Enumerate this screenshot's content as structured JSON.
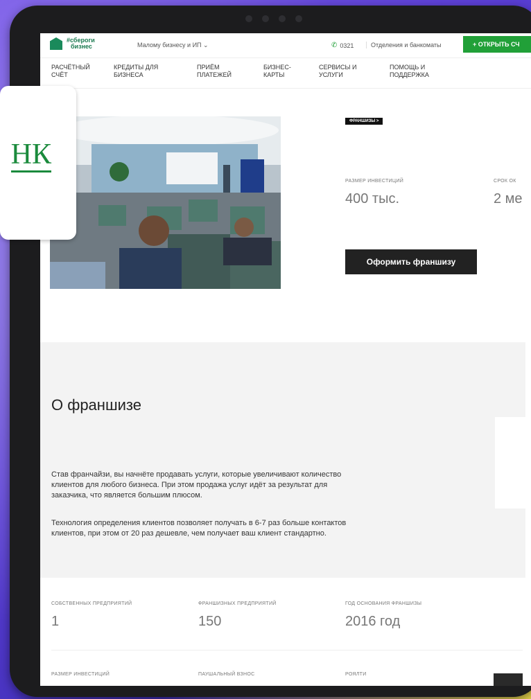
{
  "header": {
    "logo_line1": "#сбероги",
    "logo_line2": "бизнес",
    "segment": "Малому бизнесу и ИП ⌄",
    "phone": "0321",
    "branches": "Отделения и банкоматы",
    "open_account": "+ ОТКРЫТЬ СЧ"
  },
  "nav": [
    {
      "l1": "РАСЧЁТНЫЙ",
      "l2": "СЧЁТ"
    },
    {
      "l1": "КРЕДИТЫ ДЛЯ",
      "l2": "БИЗНЕСА"
    },
    {
      "l1": "ПРИЁМ",
      "l2": "ПЛАТЕЖЕЙ"
    },
    {
      "l1": "БИЗНЕС-",
      "l2": "КАРТЫ"
    },
    {
      "l1": "СЕРВИСЫ И",
      "l2": "УСЛУГИ"
    },
    {
      "l1": "ПОМОЩЬ И",
      "l2": "ПОДДЕРЖКА"
    }
  ],
  "hero": {
    "tag": "ФРАНШИЗЫ >",
    "investment_label": "РАЗМЕР ИНВЕСТИЦИЙ",
    "investment_value": "400 тыс.",
    "term_label": "СРОК ОК",
    "term_value": "2 ме",
    "cta": "Оформить франшизу"
  },
  "left_card_text": "НК",
  "about": {
    "title": "О франшизе",
    "p1_l1": "Став франчайзи, вы начнёте продавать услуги, которые увеличивают количество",
    "p1_l2": "клиентов для любого бизнеса. При этом продажа услуг идёт за результат для",
    "p1_l3": "заказчика, что является большим плюсом.",
    "p2_l1": "Технология определения клиентов позволяет получать в 6-7 раз больше контактов",
    "p2_l2": "клиентов, при этом от 20 раз дешевле, чем получает ваш клиент стандартно."
  },
  "stats": [
    {
      "label": "СОБСТВЕННЫХ ПРЕДПРИЯТИЙ",
      "value": "1"
    },
    {
      "label": "ФРАНШИЗНЫХ ПРЕДПРИЯТИЙ",
      "value": "150"
    },
    {
      "label": "ГОД ОСНОВАНИЯ ФРАНШИЗЫ",
      "value": "2016 год"
    }
  ],
  "stats2": [
    "РАЗМЕР ИНВЕСТИЦИЙ",
    "ПАУШАЛЬНЫЙ ВЗНОС",
    "РОЯЛТИ"
  ]
}
